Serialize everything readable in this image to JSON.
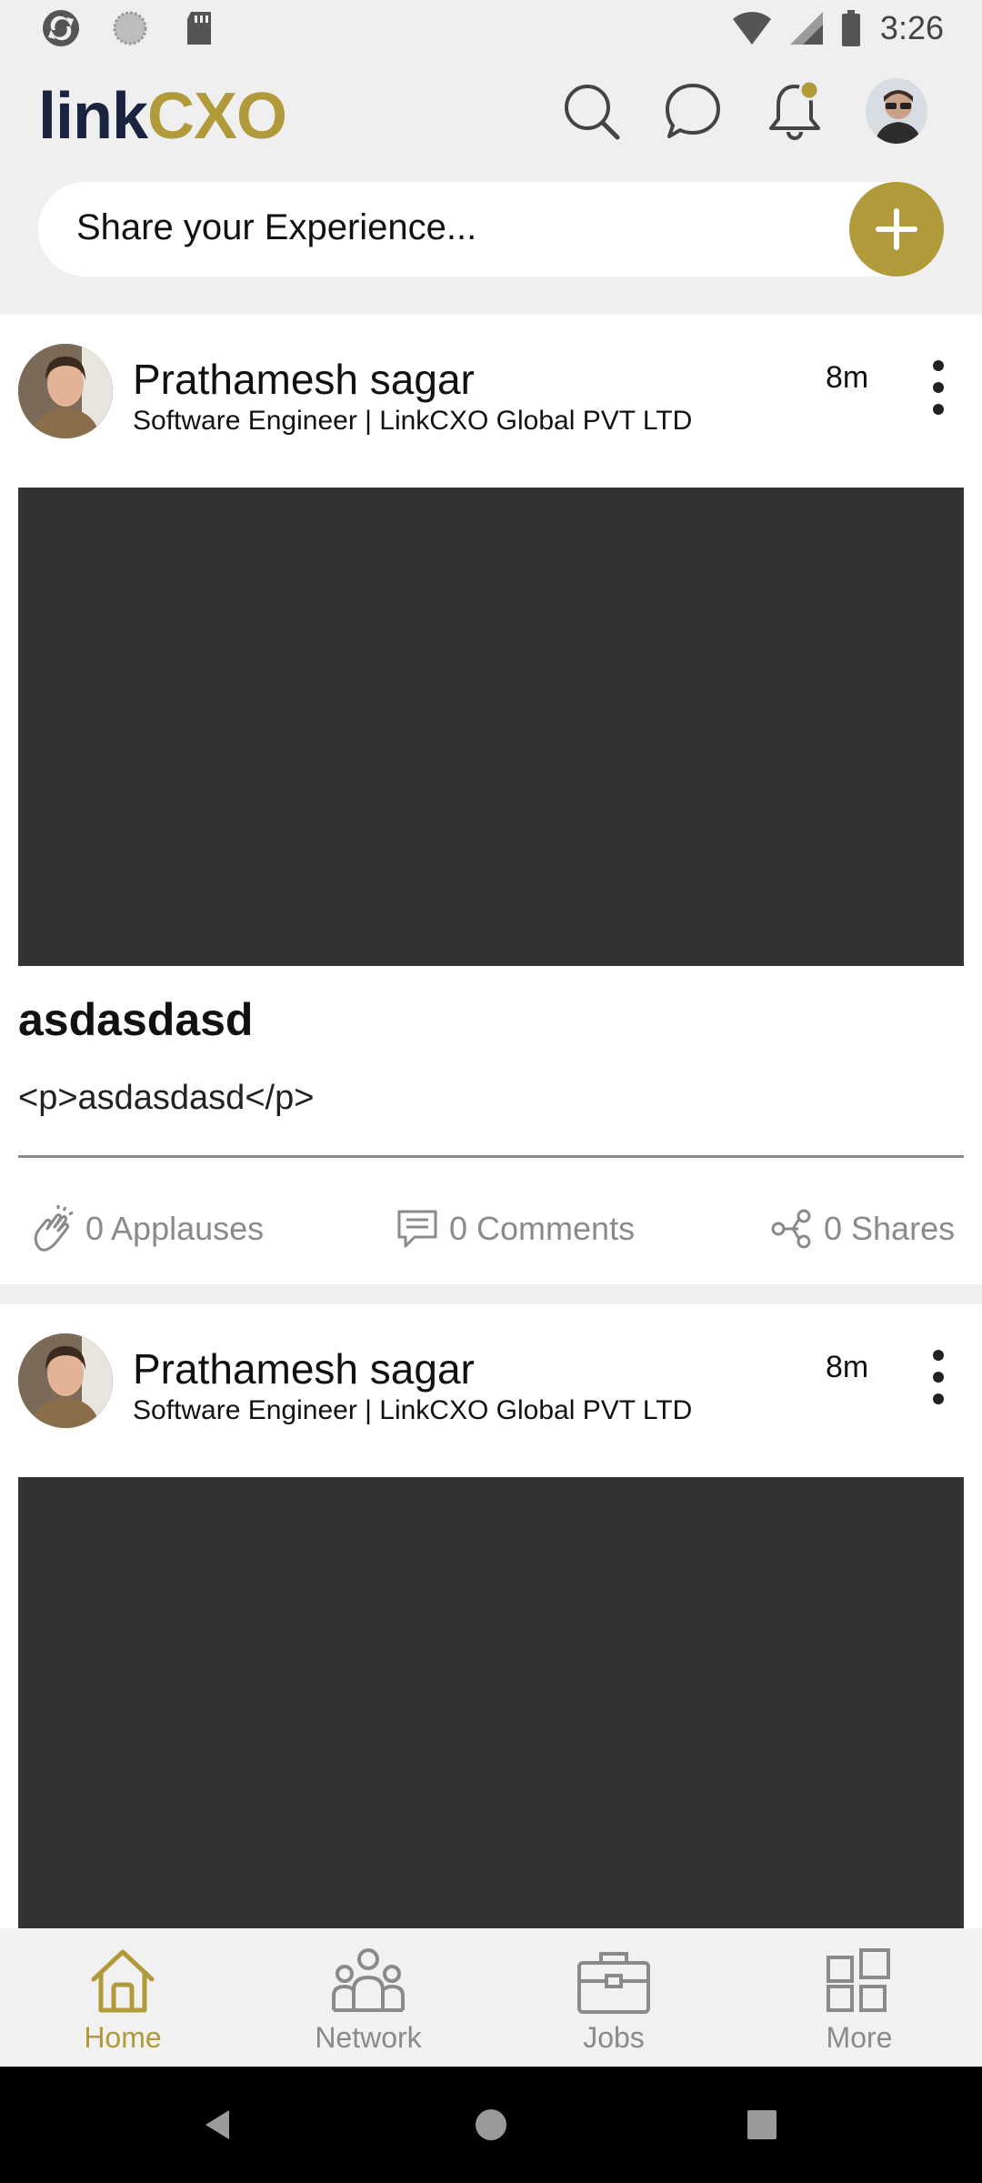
{
  "status_bar": {
    "time": "3:26",
    "left_icons": [
      "sync-icon",
      "circle-icon",
      "sd-card-icon"
    ],
    "right_icons": [
      "wifi-icon",
      "signal-icon",
      "battery-icon"
    ]
  },
  "header": {
    "logo_part1": "link",
    "logo_part2": "CXO",
    "icons": [
      "search-icon",
      "chat-icon",
      "bell-icon",
      "profile-avatar"
    ],
    "share_placeholder": "Share your Experience...",
    "add_icon": "plus-icon",
    "accent_color": "#b09a3a",
    "brand_dark": "#1a2340"
  },
  "posts": [
    {
      "author": "Prathamesh sagar",
      "title": "Software  Engineer | LinkCXO Global PVT LTD",
      "time": "8m",
      "heading": "asdasdasd",
      "body": "<p>asdasdasd</p>",
      "applauses": "0 Applauses",
      "comments": "0 Comments",
      "shares": "0 Shares"
    },
    {
      "author": "Prathamesh sagar",
      "title": "Software  Engineer | LinkCXO Global PVT LTD",
      "time": "8m"
    }
  ],
  "bottom_nav": {
    "items": [
      {
        "label": "Home",
        "icon": "home-icon",
        "active": true
      },
      {
        "label": "Network",
        "icon": "network-icon",
        "active": false
      },
      {
        "label": "Jobs",
        "icon": "briefcase-icon",
        "active": false
      },
      {
        "label": "More",
        "icon": "grid-icon",
        "active": false
      }
    ]
  },
  "system_nav": [
    "back-icon",
    "home-circle-icon",
    "recents-icon"
  ]
}
